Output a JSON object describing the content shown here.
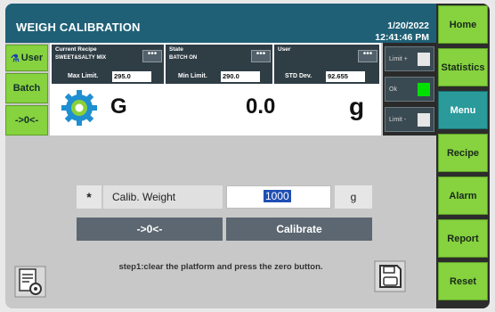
{
  "header": {
    "title": "WEIGH CALIBRATION",
    "date": "1/20/2022",
    "time": "12:41:46 PM"
  },
  "right_nav": [
    {
      "label": "Home",
      "active": false
    },
    {
      "label": "Statistics",
      "active": false
    },
    {
      "label": "Menu",
      "active": true
    },
    {
      "label": "Recipe",
      "active": false
    },
    {
      "label": "Alarm",
      "active": false
    },
    {
      "label": "Report",
      "active": false
    },
    {
      "label": "Reset",
      "active": false
    }
  ],
  "left_nav": {
    "user": "User",
    "batch": "Batch",
    "zero": "->0<-"
  },
  "info": {
    "recipe": {
      "label": "Current Recipe",
      "value": "SWEET&SALTY MIX"
    },
    "state": {
      "label": "State",
      "value": "BATCH ON"
    },
    "user": {
      "label": "User",
      "value": ""
    },
    "dots": "•••"
  },
  "limits": {
    "max_label": "Max Limit.",
    "max_value": "295.0",
    "min_label": "Min Limit.",
    "min_value": "290.0",
    "std_label": "STD Dev.",
    "std_value": "92.655"
  },
  "display": {
    "unit_code": "G",
    "weight": "0.0",
    "unit": "g"
  },
  "indicators": {
    "limit_plus": "Limit +",
    "ok": "Ok",
    "limit_minus": "Limit -"
  },
  "calibration": {
    "asterisk": "*",
    "label": "Calib. Weight",
    "value": "1000",
    "unit": "g",
    "zero_button": "->0<-",
    "calibrate_button": "Calibrate",
    "instruction": "step1:clear the platform and press the zero button."
  },
  "colors": {
    "header": "#1f6076",
    "nav_green": "#86d23f",
    "nav_active": "#2a9a9a",
    "ok_indicator": "#00e000"
  }
}
